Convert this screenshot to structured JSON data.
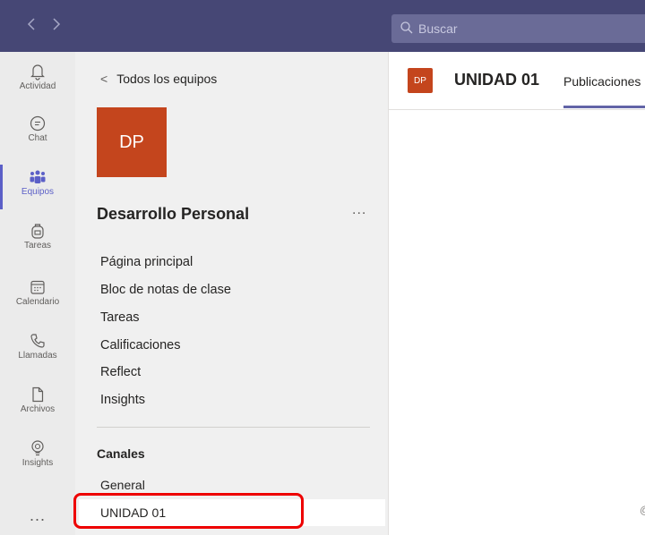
{
  "topbar": {
    "search_placeholder": "Buscar",
    "back_icon": "chevron-left-icon",
    "forward_icon": "chevron-right-icon",
    "color": "#464775"
  },
  "rail": {
    "items": [
      {
        "label": "Actividad",
        "icon": "bell-icon"
      },
      {
        "label": "Chat",
        "icon": "chat-icon"
      },
      {
        "label": "Equipos",
        "icon": "teams-icon",
        "active": true
      },
      {
        "label": "Tareas",
        "icon": "backpack-icon"
      },
      {
        "label": "Calendario",
        "icon": "calendar-icon"
      },
      {
        "label": "Llamadas",
        "icon": "phone-icon"
      },
      {
        "label": "Archivos",
        "icon": "file-icon"
      },
      {
        "label": "Insights",
        "icon": "lightbulb-icon"
      }
    ],
    "more": "...",
    "accent": "#5b5fc7"
  },
  "panel": {
    "back_label": "Todos los equipos",
    "team_initials": "DP",
    "team_name": "Desarrollo Personal",
    "team_more": "...",
    "menu": [
      "Página principal",
      "Bloc de notas de clase",
      "Tareas",
      "Calificaciones",
      "Reflect",
      "Insights"
    ],
    "channels_title": "Canales",
    "channels": [
      "General",
      "UNIDAD 01"
    ],
    "selected_channel": "UNIDAD 01",
    "team_color": "#c4451d"
  },
  "main": {
    "channel_initials": "DP",
    "channel_title": "UNIDAD 01",
    "tab_label": "Publicaciones",
    "tab_accent": "#6264a7"
  },
  "annotation": {
    "highlight_color": "#ee0000"
  },
  "corner_glyph": "@"
}
